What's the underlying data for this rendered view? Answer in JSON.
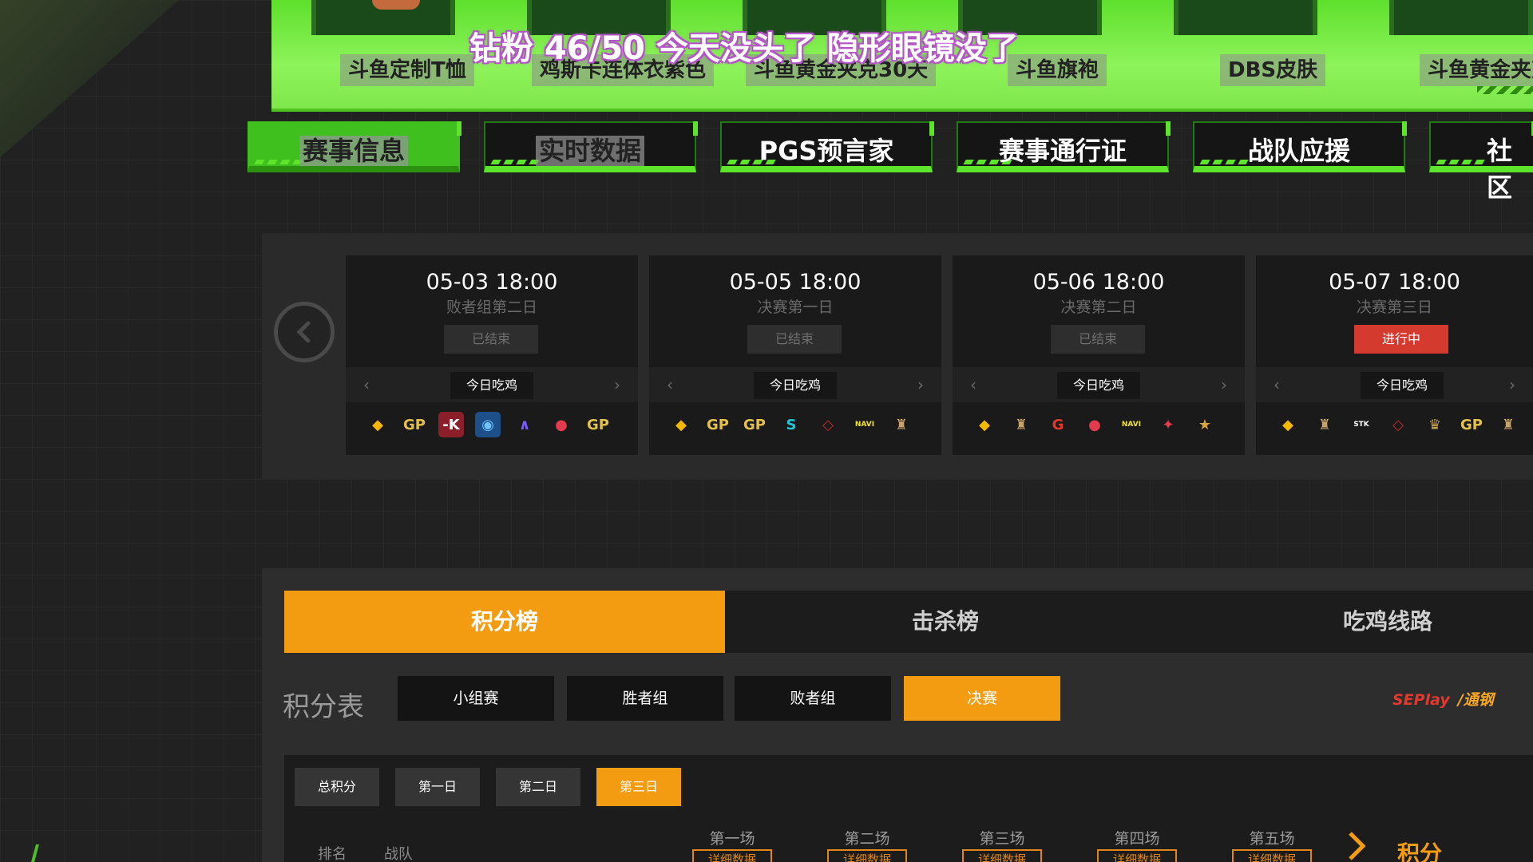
{
  "overlay": {
    "text": "钻粉 46/50  今天没头了 隐形眼镜没了"
  },
  "prizes": [
    {
      "label": "斗鱼定制T恤"
    },
    {
      "label": "鸡斯卡连体衣紫色"
    },
    {
      "label": "斗鱼黄金夹克30天"
    },
    {
      "label": "斗鱼旗袍"
    },
    {
      "label": "DBS皮肤"
    },
    {
      "label": "斗鱼黄金夹克"
    }
  ],
  "nav": [
    {
      "label": "赛事信息"
    },
    {
      "label": "实时数据"
    },
    {
      "label": "PGS预言家"
    },
    {
      "label": "赛事通行证"
    },
    {
      "label": "战队应援"
    },
    {
      "label": "社区"
    }
  ],
  "schedule": {
    "cards": [
      {
        "date": "05-03 18:00",
        "stage": "败者组第二日",
        "status": "已结束",
        "tag": "今日吃鸡",
        "logos": [
          {
            "t": "◆",
            "c": "#f5b800",
            "bg": "transparent"
          },
          {
            "t": "GP",
            "c": "#e3c14a",
            "bg": "transparent"
          },
          {
            "t": "-K",
            "c": "#fff",
            "bg": "#8a1f2a"
          },
          {
            "t": "◉",
            "c": "#6fc4ff",
            "bg": "#1d4f8a"
          },
          {
            "t": "∧",
            "c": "#7a5cff",
            "bg": "transparent"
          },
          {
            "t": "●",
            "c": "#e23b4e",
            "bg": "transparent"
          },
          {
            "t": "GP",
            "c": "#e3c14a",
            "bg": "transparent"
          }
        ]
      },
      {
        "date": "05-05 18:00",
        "stage": "决赛第一日",
        "status": "已结束",
        "tag": "今日吃鸡",
        "logos": [
          {
            "t": "◆",
            "c": "#f5b800",
            "bg": "transparent"
          },
          {
            "t": "GP",
            "c": "#e3c14a",
            "bg": "transparent"
          },
          {
            "t": "GP",
            "c": "#e3c14a",
            "bg": "transparent"
          },
          {
            "t": "S",
            "c": "#23c6d6",
            "bg": "transparent"
          },
          {
            "t": "◇",
            "c": "#c02a2a",
            "bg": "transparent"
          },
          {
            "t": "NAVI",
            "c": "#f2e230",
            "bg": "transparent"
          },
          {
            "t": "♜",
            "c": "#c7a26b",
            "bg": "transparent"
          }
        ]
      },
      {
        "date": "05-06 18:00",
        "stage": "决赛第二日",
        "status": "已结束",
        "tag": "今日吃鸡",
        "logos": [
          {
            "t": "◆",
            "c": "#f5b800",
            "bg": "transparent"
          },
          {
            "t": "♜",
            "c": "#c7a26b",
            "bg": "transparent"
          },
          {
            "t": "G",
            "c": "#e2392a",
            "bg": "transparent"
          },
          {
            "t": "●",
            "c": "#e23b4e",
            "bg": "transparent"
          },
          {
            "t": "NAVI",
            "c": "#f2e230",
            "bg": "transparent"
          },
          {
            "t": "✦",
            "c": "#e23b4e",
            "bg": "transparent"
          },
          {
            "t": "★",
            "c": "#d9a441",
            "bg": "transparent"
          }
        ]
      },
      {
        "date": "05-07 18:00",
        "stage": "决赛第三日",
        "status": "进行中",
        "tag": "今日吃鸡",
        "logos": [
          {
            "t": "◆",
            "c": "#f5b800",
            "bg": "transparent"
          },
          {
            "t": "♜",
            "c": "#c7a26b",
            "bg": "transparent"
          },
          {
            "t": "STK",
            "c": "#fff",
            "bg": "transparent"
          },
          {
            "t": "◇",
            "c": "#c02a2a",
            "bg": "transparent"
          },
          {
            "t": "♛",
            "c": "#c9a24b",
            "bg": "transparent"
          },
          {
            "t": "GP",
            "c": "#e3c14a",
            "bg": "transparent"
          },
          {
            "t": "♜",
            "c": "#c7a26b",
            "bg": "transparent"
          }
        ]
      }
    ]
  },
  "board": {
    "tabs": [
      {
        "label": "积分榜"
      },
      {
        "label": "击杀榜"
      },
      {
        "label": "吃鸡线路"
      }
    ],
    "section_label": "积分表",
    "stage_tabs": [
      {
        "label": "小组赛"
      },
      {
        "label": "胜者组"
      },
      {
        "label": "败者组"
      },
      {
        "label": "决赛"
      }
    ],
    "sponsor": {
      "a": "SEPlay",
      "b": "/通钢"
    },
    "day_tabs": [
      {
        "label": "总积分"
      },
      {
        "label": "第一日"
      },
      {
        "label": "第二日"
      },
      {
        "label": "第三日"
      }
    ],
    "columns": {
      "rank": "排名",
      "team": "战队",
      "score": "积分"
    },
    "rounds": [
      {
        "label": "第一场",
        "detail": "详细数据"
      },
      {
        "label": "第二场",
        "detail": "详细数据"
      },
      {
        "label": "第三场",
        "detail": "详细数据"
      },
      {
        "label": "第四场",
        "detail": "详细数据"
      },
      {
        "label": "第五场",
        "detail": "详细数据"
      }
    ]
  },
  "colors": {
    "accent": "#f39c12",
    "green": "#5fe42c",
    "live": "#d53a2e"
  }
}
